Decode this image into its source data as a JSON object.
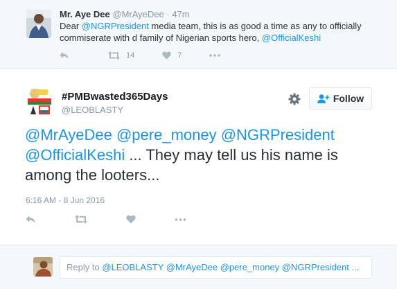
{
  "parent_tweet": {
    "name": "Mr. Aye Dee",
    "handle": "@MrAyeDee",
    "time": "· 47m",
    "text_before": "Dear ",
    "mention_1": "@NGRPresident",
    "text_middle": " media team, this is as good a time as any to officially commiserate with d family of Nigerian sports hero, ",
    "mention_2": "@OfficialKeshi",
    "retweet_count": "14",
    "like_count": "7"
  },
  "main_tweet": {
    "name": "#PMBwasted365Days",
    "handle": "@LEOBLASTY",
    "follow_label": "Follow",
    "mentions": "@MrAyeDee @pere_money @NGRPresident @OfficialKeshi",
    "text": " ... They may tell us his name is among the looters...",
    "timestamp": "6:16 AM - 8 Jun 2016"
  },
  "reply_box": {
    "prefix": "Reply to ",
    "mentions": "@LEOBLASTY @MrAyeDee @pere_money @NGRPresident ..."
  },
  "colors": {
    "link": "#1b95e0",
    "icon_gray": "#aab8c2",
    "muted_text": "#8899a6",
    "reply_bg": "#f5f8fa"
  },
  "icons": [
    "reply-icon",
    "retweet-icon",
    "heart-icon",
    "more-icon",
    "gear-icon",
    "follow-person-icon"
  ]
}
